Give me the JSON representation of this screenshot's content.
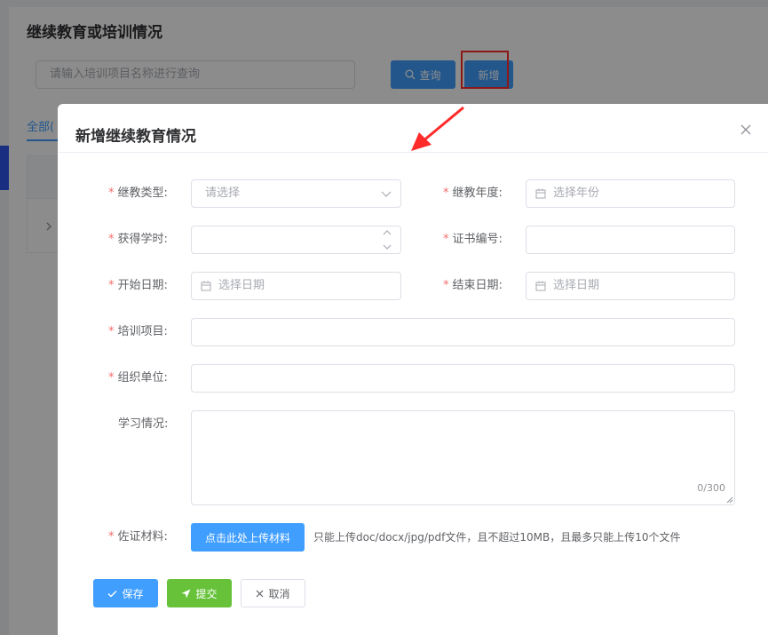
{
  "background": {
    "title": "继续教育或培训情况",
    "search_placeholder": "请输入培训项目名称进行查询",
    "query_label": "查询",
    "add_label": "新增",
    "tab_label": "全部("
  },
  "dialog": {
    "title": "新增继续教育情况",
    "fields": {
      "type_label": "继教类型:",
      "type_placeholder": "请选择",
      "year_label": "继教年度:",
      "year_placeholder": "选择年份",
      "hours_label": "获得学时:",
      "cert_label": "证书编号:",
      "start_label": "开始日期:",
      "start_placeholder": "选择日期",
      "end_label": "结束日期:",
      "end_placeholder": "选择日期",
      "project_label": "培训项目:",
      "org_label": "组织单位:",
      "study_label": "学习情况:",
      "study_counter": "0/300",
      "material_label": "佐证材料:"
    },
    "required_mark": "*",
    "upload_label": "点击此处上传材料",
    "upload_tip": "只能上传doc/docx/jpg/pdf文件，且不超过10MB，且最多只能上传10个文件",
    "buttons": {
      "save": "保存",
      "submit": "提交",
      "cancel": "取消"
    }
  },
  "colors": {
    "primary": "#409eff",
    "success": "#67c23a",
    "required": "#f56c6c",
    "annotation_red": "#ff2b2b"
  },
  "icons": {
    "query": "search-icon",
    "close": "close-icon",
    "select": "chevron-down-icon",
    "date": "calendar-icon",
    "save": "check-icon",
    "submit": "send-icon",
    "cancel": "x-icon"
  }
}
